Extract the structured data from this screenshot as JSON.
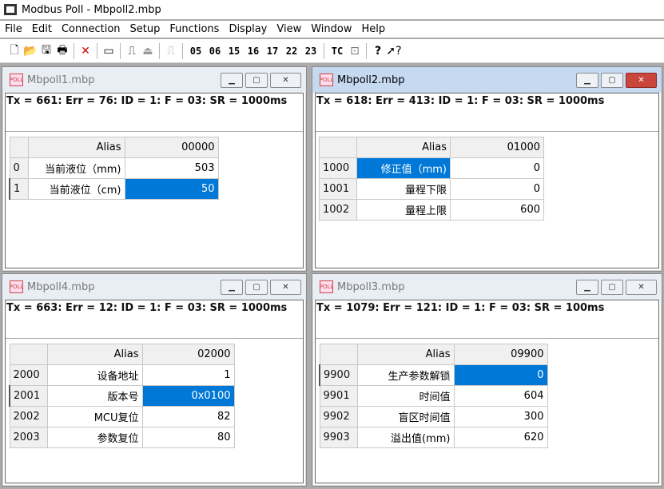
{
  "app": {
    "title": "Modbus Poll - Mbpoll2.mbp"
  },
  "menu": [
    "File",
    "Edit",
    "Connection",
    "Setup",
    "Functions",
    "Display",
    "View",
    "Window",
    "Help"
  ],
  "toolbar": {
    "fc_codes": [
      "05",
      "06",
      "15",
      "16",
      "17",
      "22",
      "23"
    ],
    "tc_label": "TC"
  },
  "windows": {
    "w1": {
      "name": "Mbpoll1.mbp",
      "status": "Tx = 661: Err = 76: ID = 1: F = 03: SR = 1000ms",
      "alias_header": "Alias",
      "col_header": "00000",
      "rows": [
        {
          "n": "0",
          "alias": "当前液位（mm)",
          "value": "503"
        },
        {
          "n": "1",
          "alias": "当前液位（cm)",
          "value": "50"
        }
      ]
    },
    "w2": {
      "name": "Mbpoll2.mbp",
      "status": "Tx = 618: Err = 413: ID = 1: F = 03: SR = 1000ms",
      "alias_header": "Alias",
      "col_header": "01000",
      "rows": [
        {
          "n": "1000",
          "alias": "修正值（mm)",
          "value": "0"
        },
        {
          "n": "1001",
          "alias": "量程下限",
          "value": "0"
        },
        {
          "n": "1002",
          "alias": "量程上限",
          "value": "600"
        }
      ]
    },
    "w4": {
      "name": "Mbpoll4.mbp",
      "status": "Tx = 663: Err = 12: ID = 1: F = 03: SR = 1000ms",
      "alias_header": "Alias",
      "col_header": "02000",
      "rows": [
        {
          "n": "2000",
          "alias": "设备地址",
          "value": "1"
        },
        {
          "n": "2001",
          "alias": "版本号",
          "value": "0x0100"
        },
        {
          "n": "2002",
          "alias": "MCU复位",
          "value": "82"
        },
        {
          "n": "2003",
          "alias": "参数复位",
          "value": "80"
        }
      ]
    },
    "w3": {
      "name": "Mbpoll3.mbp",
      "status": "Tx = 1079: Err = 121: ID = 1: F = 03: SR = 100ms",
      "alias_header": "Alias",
      "col_header": "09900",
      "rows": [
        {
          "n": "9900",
          "alias": "生产参数解锁",
          "value": "0"
        },
        {
          "n": "9901",
          "alias": "时间值",
          "value": "604"
        },
        {
          "n": "9902",
          "alias": "盲区时间值",
          "value": "300"
        },
        {
          "n": "9903",
          "alias": "溢出值(mm)",
          "value": "620"
        }
      ]
    }
  }
}
